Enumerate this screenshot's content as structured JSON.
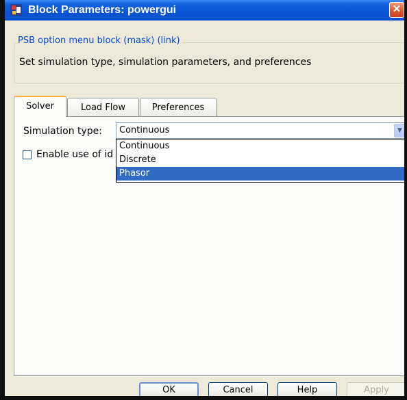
{
  "window": {
    "title": "Block Parameters: powergui",
    "close_glyph": "✕"
  },
  "description_group": {
    "legend": "PSB option menu block (mask) (link)",
    "text": "Set simulation type, simulation parameters, and preferences"
  },
  "tabs": [
    {
      "label": "Solver",
      "active": true
    },
    {
      "label": "Load Flow",
      "active": false
    },
    {
      "label": "Preferences",
      "active": false
    }
  ],
  "solver": {
    "simulation_type_label": "Simulation type:",
    "simulation_type_value": "Continuous",
    "dropdown_options": [
      "Continuous",
      "Discrete",
      "Phasor"
    ],
    "highlighted_option": "Phasor",
    "checkbox_label": "Enable use of id",
    "checkbox_checked": false
  },
  "buttons": {
    "ok": "OK",
    "cancel": "Cancel",
    "help": "Help",
    "apply": "Apply"
  },
  "colors": {
    "titlebar": "#0a55d6",
    "selection": "#316ac5",
    "legend_text": "#0046d5"
  }
}
